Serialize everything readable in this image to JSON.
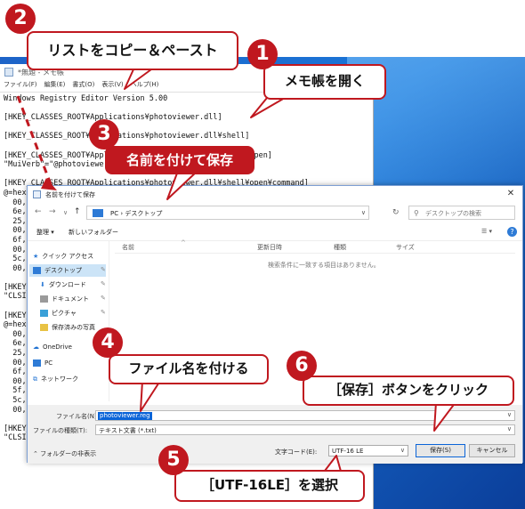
{
  "notepad": {
    "title": "*無題 - メモ帳",
    "menu": [
      "ファイル(F)",
      "編集(E)",
      "書式(O)",
      "表示(V)",
      "ヘルプ(H)"
    ],
    "lines": [
      "Windows Registry Editor Version 5.00",
      "",
      "[HKEY_CLASSES_ROOT¥Applications¥photoviewer.dll]",
      "",
      "[HKEY_CLASSES_ROOT¥Applications¥photoviewer.dll¥shell]",
      "",
      "[HKEY_CLASSES_ROOT¥Applications¥photoviewer.dll¥shell¥open]",
      "\"MuiVerb\"=\"@photoviewer.dll,-3043\"",
      "",
      "[HKEY_CLASSES_ROOT¥Applications¥photoviewer.dll¥shell¥open¥command]",
      "@=hex(2):25,00,79,00,73,00,74,00,65,00,6d,00,52,00,6f,00,6f,00,74,00,25,¥",
      "  00,5c,",
      "  6e,00,",
      "  25,00,",
      "  00,74,",
      "  6f,00,",
      "  00,22,",
      "  5c,00,",
      "  00,31,",
      "",
      "[HKEY_",
      "\"CLSID",
      "",
      "[HKEY_",
      "@=hex",
      "  00,5c,",
      "  6e,00,",
      "  25,00,",
      "  00,74,",
      "  6f,00,",
      "  00,22,",
      "  5f,00,",
      "  5c,00,",
      "  00,31,",
      "",
      "[HKEY_",
      "\"CLSID"
    ]
  },
  "dialog": {
    "title": "名前を付けて保存",
    "close": "✕",
    "address": [
      "PC",
      "デスクトップ"
    ],
    "search_placeholder": "デスクトップの検索",
    "organize": "整理 ▾",
    "new_folder": "新しいフォルダー",
    "view_icon": "☰ ▾",
    "help": "?",
    "nav": [
      {
        "label": "クイック アクセス",
        "color": "#2e7bd6"
      },
      {
        "label": "デスクトップ",
        "color": "#2e7bd6"
      },
      {
        "label": "ダウンロード",
        "color": "#2e7bd6"
      },
      {
        "label": "ドキュメント",
        "color": "#8a8a8a"
      },
      {
        "label": "ピクチャ",
        "color": "#3aa0d8"
      },
      {
        "label": "保存済みの写真",
        "color": "#e8c244"
      },
      {
        "label": "OneDrive",
        "color": "#1e70d0"
      },
      {
        "label": "PC",
        "color": "#2e7bd6"
      },
      {
        "label": "ネットワーク",
        "color": "#2e7bd6"
      }
    ],
    "columns": [
      "名前",
      "更新日時",
      "種類",
      "サイズ"
    ],
    "empty_message": "検索条件に一致する項目はありません。",
    "filename_label": "ファイル名(N):",
    "filename_value": "photoviewer.reg",
    "filetype_label": "ファイルの種類(T):",
    "filetype_value": "テキスト文書 (*.txt)",
    "hide_folders": "フォルダーの非表示",
    "encoding_label": "文字コード(E):",
    "encoding_value": "UTF-16 LE",
    "save_button": "保存(S)",
    "cancel_button": "キャンセル"
  },
  "callouts": [
    {
      "num": "1",
      "text": "メモ帳を開く"
    },
    {
      "num": "2",
      "text": "リストをコピー＆ペースト"
    },
    {
      "num": "3",
      "text": "名前を付けて保存"
    },
    {
      "num": "4",
      "text": "ファイル名を付ける"
    },
    {
      "num": "5",
      "text": "［UTF-16LE］を選択"
    },
    {
      "num": "6",
      "text": "［保存］ボタンをクリック"
    }
  ],
  "colors": {
    "accent": "#c0181f",
    "selection": "#0a64d8",
    "desktop": "#1a6fd6"
  }
}
